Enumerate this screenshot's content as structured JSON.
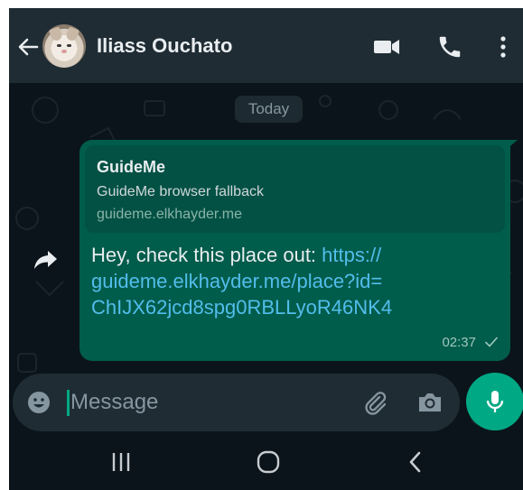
{
  "header": {
    "contact_name": "Iliass Ouchato",
    "icons": [
      "back-arrow-icon",
      "video-call-icon",
      "voice-call-icon",
      "more-options-icon"
    ]
  },
  "chat": {
    "date_chip": "Today",
    "message": {
      "preview_title": "GuideMe",
      "preview_description": "GuideMe browser fallback",
      "preview_domain": "guideme.elkhayder.me",
      "text": "Hey, check this place out: ",
      "link_lines": [
        "https://",
        "guideme.elkhayder.me/place?id=",
        "ChIJX62jcd8spg0RBLLyoR46NK4"
      ],
      "time": "02:37",
      "status": "sent"
    }
  },
  "composer": {
    "placeholder": "Message",
    "value": ""
  },
  "colors": {
    "header_bg": "#1f2c34",
    "chat_bg": "#0b141a",
    "outgoing_bubble": "#005c4b",
    "link": "#53bdeb",
    "accent": "#00a884"
  },
  "navbar": {
    "icons": [
      "recent-apps-icon",
      "home-icon",
      "nav-back-icon"
    ]
  }
}
